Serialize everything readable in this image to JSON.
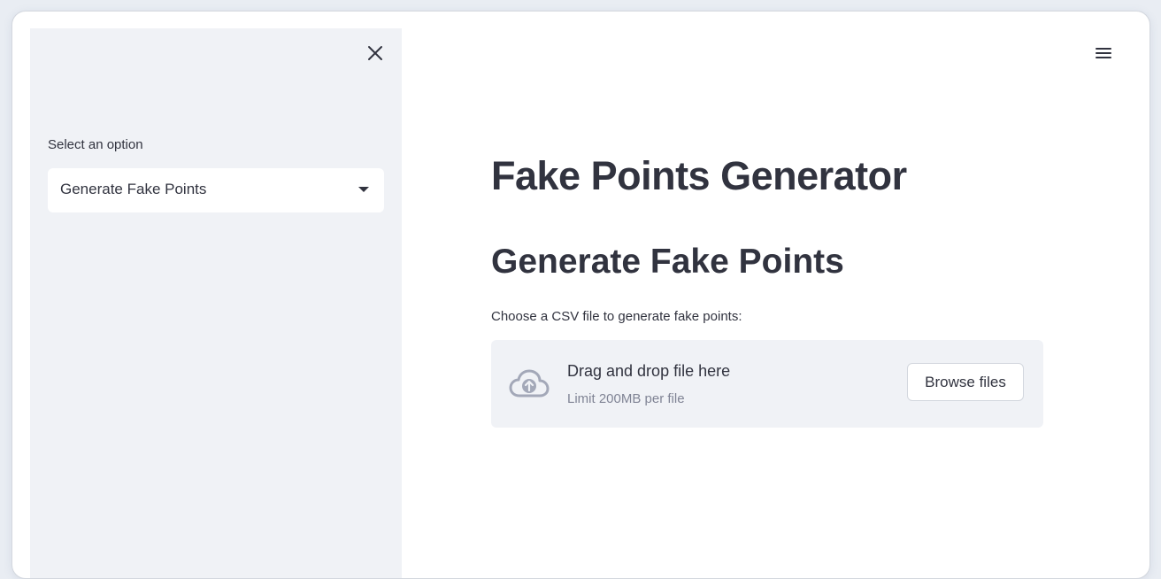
{
  "sidebar": {
    "close_icon": "close-icon",
    "select_label": "Select an option",
    "select_value": "Generate Fake Points",
    "caret_icon": "caret-down-icon"
  },
  "header": {
    "menu_icon": "hamburger-menu-icon"
  },
  "main": {
    "title": "Fake Points Generator",
    "subheader": "Generate Fake Points",
    "uploader": {
      "label": "Choose a CSV file to generate fake points:",
      "icon": "cloud-upload-icon",
      "drop_text": "Drag and drop file here",
      "limit_text": "Limit 200MB per file",
      "browse_label": "Browse files"
    }
  },
  "colors": {
    "sidebar_bg": "#f0f2f6",
    "text": "#31333f",
    "muted_text": "#808495",
    "icon": "#a3a8b8"
  }
}
